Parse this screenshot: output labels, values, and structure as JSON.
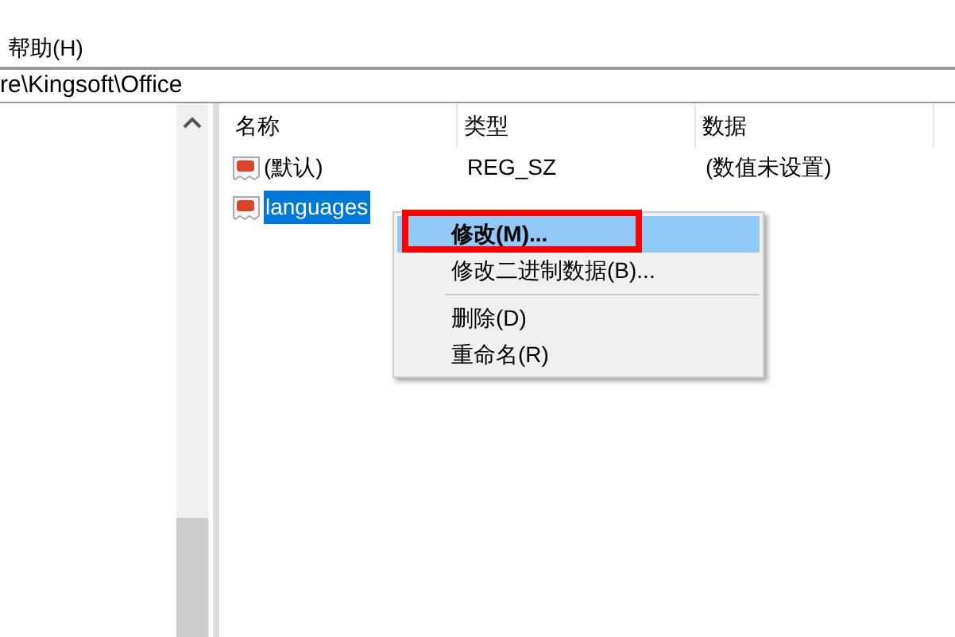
{
  "menu_bar": {
    "items": [
      "帮助(H)"
    ]
  },
  "address_bar": {
    "path": "re\\Kingsoft\\Office"
  },
  "table": {
    "columns": [
      "名称",
      "类型",
      "数据"
    ],
    "rows": [
      {
        "name": "(默认)",
        "type": "REG_SZ",
        "data": "(数值未设置)",
        "selected": false
      },
      {
        "name": "languages",
        "selected": true
      }
    ]
  },
  "context_menu": {
    "items": [
      {
        "kind": "item",
        "label": "修改(M)...",
        "selected": true,
        "annotated": true
      },
      {
        "kind": "item",
        "label": "修改二进制数据(B)...",
        "selected": false,
        "annotated": false
      },
      {
        "kind": "separator"
      },
      {
        "kind": "item",
        "label": "删除(D)",
        "selected": false,
        "annotated": false
      },
      {
        "kind": "item",
        "label": "重命名(R)",
        "selected": false,
        "annotated": false
      }
    ]
  }
}
